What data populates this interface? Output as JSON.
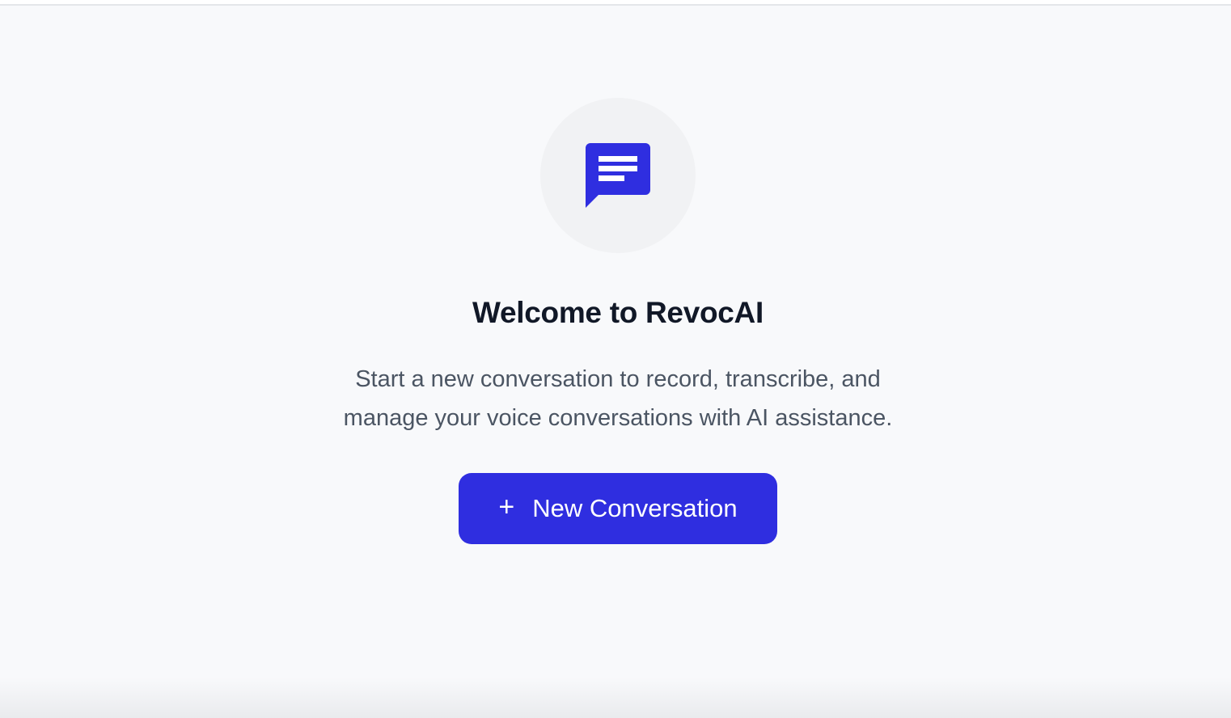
{
  "welcome": {
    "title": "Welcome to RevocAI",
    "subtitle_line1": "Start a new conversation to record, transcribe, and",
    "subtitle_line2": "manage your voice conversations with AI assistance.",
    "icon": "chat-bubble-icon"
  },
  "actions": {
    "new_conversation_icon": "+",
    "new_conversation_label": "New Conversation"
  },
  "colors": {
    "accent": "#2f2ee0",
    "background": "#f8f9fb",
    "icon_circle": "#f1f2f4",
    "title_text": "#111827",
    "body_text": "#4b5563"
  }
}
